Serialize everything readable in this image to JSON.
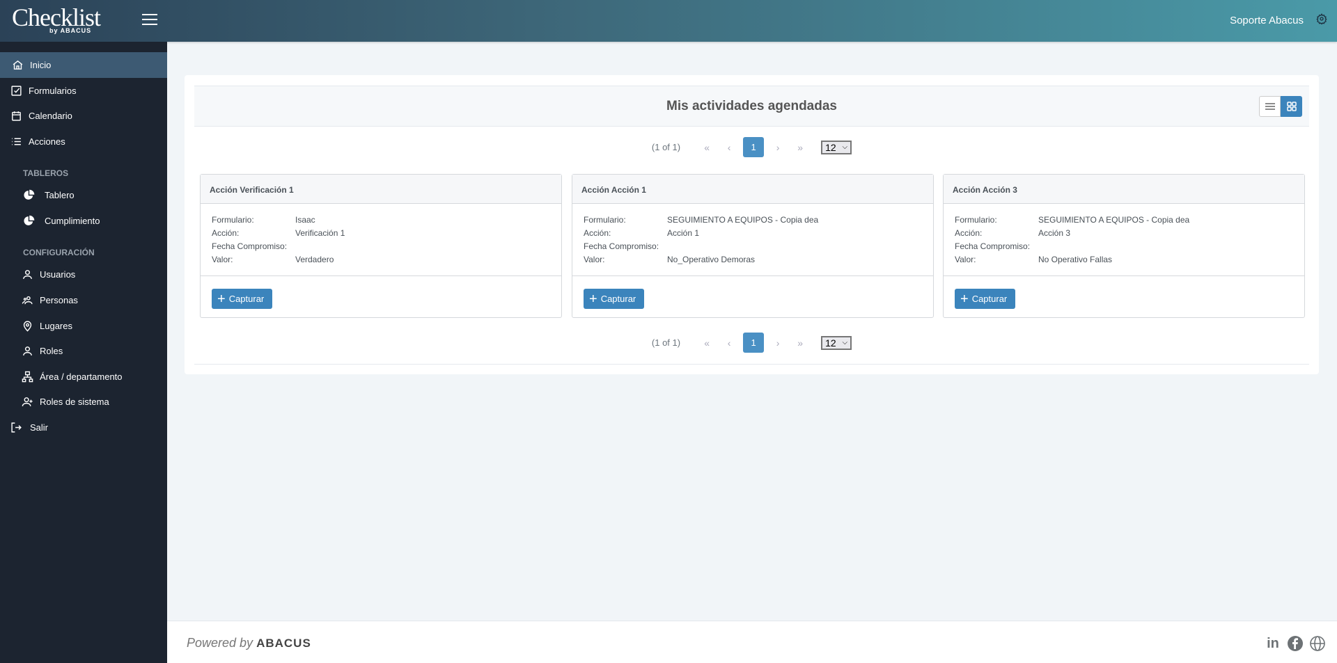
{
  "header": {
    "logo": "Checklist",
    "logo_sub": "by ABACUS",
    "user": "Soporte Abacus"
  },
  "sidebar": {
    "items": [
      {
        "label": "Inicio"
      },
      {
        "label": "Formularios"
      },
      {
        "label": "Calendario"
      },
      {
        "label": "Acciones"
      }
    ],
    "section_tableros": "TABLEROS",
    "tableros": [
      {
        "label": "Tablero"
      },
      {
        "label": "Cumplimiento"
      }
    ],
    "section_config": "CONFIGURACIÓN",
    "config": [
      {
        "label": "Usuarios"
      },
      {
        "label": "Personas"
      },
      {
        "label": "Lugares"
      },
      {
        "label": "Roles"
      },
      {
        "label": "Área / departamento"
      },
      {
        "label": "Roles de sistema"
      }
    ],
    "logout": "Salir"
  },
  "main": {
    "title": "Mis actividades agendadas",
    "pager": {
      "info": "(1 of 1)",
      "first": "«",
      "prev": "‹",
      "current": "1",
      "next": "›",
      "last": "»",
      "per_page": "12"
    },
    "labels": {
      "form": "Formulario:",
      "action": "Acción:",
      "date": "Fecha Compromiso:",
      "value": "Valor:"
    },
    "capture_label": "Capturar",
    "cards": [
      {
        "title": "Acción Verificación 1",
        "form": "Isaac",
        "action": "Verificación 1",
        "date": "",
        "value": "Verdadero"
      },
      {
        "title": "Acción Acción 1",
        "form": "SEGUIMIENTO A EQUIPOS - Copia dea",
        "action": "Acción 1",
        "date": "",
        "value": "No_Operativo Demoras"
      },
      {
        "title": "Acción Acción 3",
        "form": "SEGUIMIENTO A EQUIPOS - Copia dea",
        "action": "Acción 3",
        "date": "",
        "value": "No Operativo Fallas"
      }
    ]
  },
  "footer": {
    "powered": "Powered by",
    "brand": "ABACUS",
    "linkedin": "in"
  },
  "colors": {
    "accent": "#3b84bc",
    "sidebar": "#1c2430",
    "active": "#3d5a73"
  }
}
